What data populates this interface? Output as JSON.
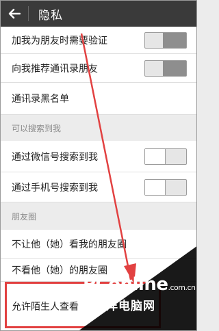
{
  "header": {
    "title": "隐私",
    "back_icon": "back-arrow-icon"
  },
  "rows": [
    {
      "label": "加我为朋友时需要验证",
      "toggle": "on"
    },
    {
      "label": "向我推荐通讯录朋友",
      "toggle": "on"
    },
    {
      "label": "通讯录黑名单"
    },
    {
      "label": "通过微信号搜索到我",
      "toggle": "off"
    },
    {
      "label": "通过手机号搜索到我",
      "toggle": "off"
    },
    {
      "label": "不让他（她）看我的朋友圈"
    },
    {
      "label": "不看他（她）的朋友圈"
    },
    {
      "label": "允许陌生人查看"
    }
  ],
  "sections": [
    {
      "label": "可以搜索到我"
    },
    {
      "label": "朋友圈"
    }
  ],
  "watermark": {
    "brand": "PConline",
    "suffix": ".com.cn",
    "tagline": "太平洋电脑网"
  },
  "colors": {
    "topbar": "#3a3a3a",
    "highlight_box": "#e24141",
    "arrow": "#e24141",
    "toggle_on": "#8e8e8e"
  }
}
